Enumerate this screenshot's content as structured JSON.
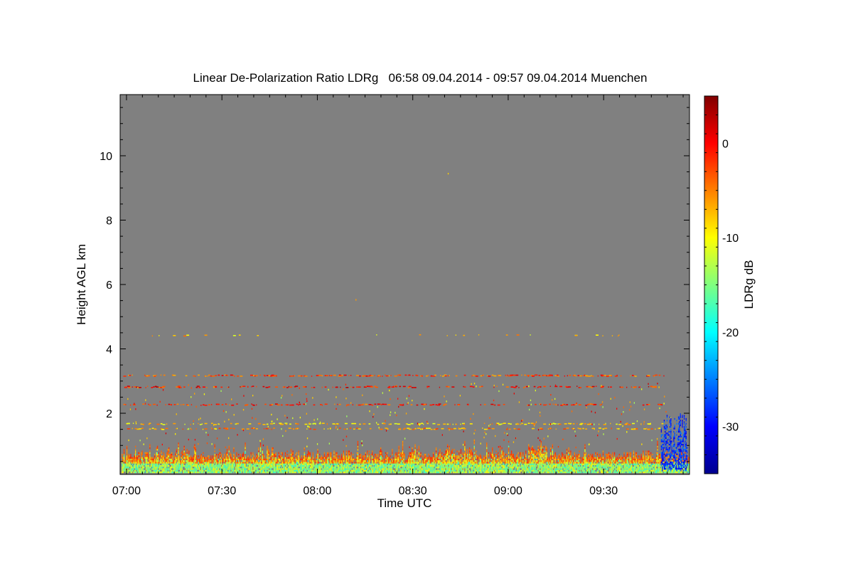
{
  "chart_data": {
    "type": "heatmap",
    "title": "Linear De-Polarization Ratio LDRg   06:58 09.04.2014 - 09:57 09.04.2014 Muenchen",
    "xlabel": "Time UTC",
    "ylabel": "Height AGL km",
    "colorbar_label": "LDRg dB",
    "x_range_minutes_utc": [
      418,
      597
    ],
    "xlim": [
      "06:58",
      "09:57"
    ],
    "x_tick_labels": [
      "07:00",
      "07:30",
      "08:00",
      "08:30",
      "09:00",
      "09:30"
    ],
    "x_ticks_minutes_utc": [
      420,
      450,
      480,
      510,
      540,
      570
    ],
    "ylim": [
      0.1,
      11.9
    ],
    "y_ticks": [
      2,
      4,
      6,
      8,
      10
    ],
    "y_tick_labels": [
      "2",
      "4",
      "6",
      "8",
      "10"
    ],
    "colorbar_range": [
      -35,
      5
    ],
    "colorbar_ticks": [
      0,
      -10,
      -20,
      -30
    ],
    "colorbar_tick_labels": [
      "0",
      "-10",
      "-20",
      "-30"
    ],
    "colormap": "jet",
    "missing_color": "#808080",
    "layers": [
      {
        "feature": "boundary layer",
        "height_km": [
          0.2,
          0.9
        ],
        "ldr_db": -12
      },
      {
        "feature": "sparse layer",
        "height_km": 1.5,
        "ldr_db": -6
      },
      {
        "feature": "sparse layer",
        "height_km": 1.65,
        "ldr_db": -8
      },
      {
        "feature": "sparse layer",
        "height_km": 2.25,
        "ldr_db": -2
      },
      {
        "feature": "sparse layer",
        "height_km": 2.8,
        "ldr_db": -1
      },
      {
        "feature": "sparse layer",
        "height_km": 3.15,
        "ldr_db": -3
      },
      {
        "feature": "sparse layer",
        "height_km": 4.4,
        "ldr_db": -8
      },
      {
        "feature": "low depolarization plume",
        "time_range": [
          "09:48",
          "09:56"
        ],
        "height_km": [
          0.2,
          2.1
        ],
        "ldr_db": -30
      }
    ]
  }
}
